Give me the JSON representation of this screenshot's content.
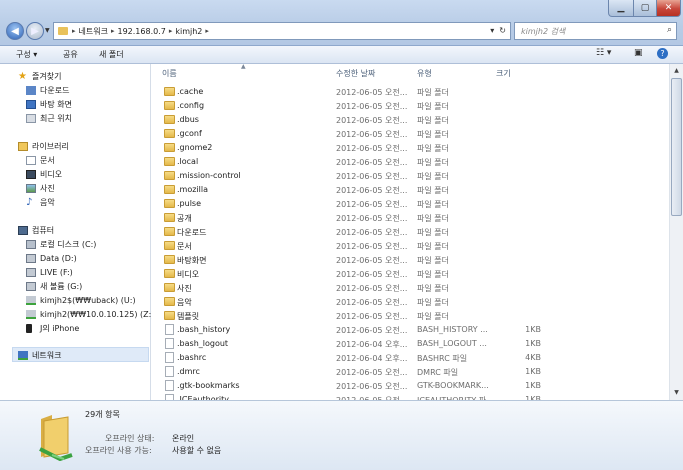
{
  "addressbar": {
    "crumbs": [
      "네트워크",
      "192.168.0.7",
      "kimjh2"
    ]
  },
  "search": {
    "placeholder": "kimjh2 검색"
  },
  "toolbar": {
    "organize": "구성 ▾",
    "share": "공유",
    "new_folder": "새 폴더"
  },
  "nav": {
    "favorites": "즐겨찾기",
    "downloads": "다운로드",
    "desktop": "바탕 화면",
    "recent": "최근 위치",
    "libraries": "라이브러리",
    "documents": "문서",
    "videos": "비디오",
    "pictures": "사진",
    "music": "음악",
    "computer": "컴퓨터",
    "local_disk": "로컬 디스크 (C:)",
    "data": "Data (D:)",
    "live": "LIVE (F:)",
    "new_volume": "새 볼륨 (G:)",
    "uback": "kimjh2$(₩₩uback) (U:)",
    "kimjh2_z": "kimjh2(₩₩10.0.10.125) (Z:)",
    "iphone": "J의 iPhone",
    "network": "네트워크"
  },
  "columns": {
    "name": "이름",
    "modified": "수정한 날짜",
    "type": "유형",
    "size": "크기"
  },
  "files": [
    {
      "name": ".cache",
      "date": "2012-06-05 오전...",
      "type": "파일 폴더",
      "size": "",
      "kind": "folder"
    },
    {
      "name": ".config",
      "date": "2012-06-05 오전...",
      "type": "파일 폴더",
      "size": "",
      "kind": "folder"
    },
    {
      "name": ".dbus",
      "date": "2012-06-05 오전...",
      "type": "파일 폴더",
      "size": "",
      "kind": "folder"
    },
    {
      "name": ".gconf",
      "date": "2012-06-05 오전...",
      "type": "파일 폴더",
      "size": "",
      "kind": "folder"
    },
    {
      "name": ".gnome2",
      "date": "2012-06-05 오전...",
      "type": "파일 폴더",
      "size": "",
      "kind": "folder"
    },
    {
      "name": ".local",
      "date": "2012-06-05 오전...",
      "type": "파일 폴더",
      "size": "",
      "kind": "folder"
    },
    {
      "name": ".mission-control",
      "date": "2012-06-05 오전...",
      "type": "파일 폴더",
      "size": "",
      "kind": "folder"
    },
    {
      "name": ".mozilla",
      "date": "2012-06-05 오전...",
      "type": "파일 폴더",
      "size": "",
      "kind": "folder"
    },
    {
      "name": ".pulse",
      "date": "2012-06-05 오전...",
      "type": "파일 폴더",
      "size": "",
      "kind": "folder"
    },
    {
      "name": "공개",
      "date": "2012-06-05 오전...",
      "type": "파일 폴더",
      "size": "",
      "kind": "folder"
    },
    {
      "name": "다운로드",
      "date": "2012-06-05 오전...",
      "type": "파일 폴더",
      "size": "",
      "kind": "folder"
    },
    {
      "name": "문서",
      "date": "2012-06-05 오전...",
      "type": "파일 폴더",
      "size": "",
      "kind": "folder"
    },
    {
      "name": "바탕화면",
      "date": "2012-06-05 오전...",
      "type": "파일 폴더",
      "size": "",
      "kind": "folder"
    },
    {
      "name": "비디오",
      "date": "2012-06-05 오전...",
      "type": "파일 폴더",
      "size": "",
      "kind": "folder"
    },
    {
      "name": "사진",
      "date": "2012-06-05 오전...",
      "type": "파일 폴더",
      "size": "",
      "kind": "folder"
    },
    {
      "name": "음악",
      "date": "2012-06-05 오전...",
      "type": "파일 폴더",
      "size": "",
      "kind": "folder"
    },
    {
      "name": "템플릿",
      "date": "2012-06-05 오전...",
      "type": "파일 폴더",
      "size": "",
      "kind": "folder"
    },
    {
      "name": ".bash_history",
      "date": "2012-06-05 오전...",
      "type": "BASH_HISTORY ...",
      "size": "1KB",
      "kind": "file"
    },
    {
      "name": ".bash_logout",
      "date": "2012-06-04 오후...",
      "type": "BASH_LOGOUT ...",
      "size": "1KB",
      "kind": "file"
    },
    {
      "name": ".bashrc",
      "date": "2012-06-04 오후...",
      "type": "BASHRC 파일",
      "size": "4KB",
      "kind": "file"
    },
    {
      "name": ".dmrc",
      "date": "2012-06-05 오전...",
      "type": "DMRC 파일",
      "size": "1KB",
      "kind": "file"
    },
    {
      "name": ".gtk-bookmarks",
      "date": "2012-06-05 오전...",
      "type": "GTK-BOOKMARK...",
      "size": "1KB",
      "kind": "file"
    },
    {
      "name": ".ICEauthority",
      "date": "2012-06-05 오전...",
      "type": "ICEAUTHORITY 파...",
      "size": "1KB",
      "kind": "file"
    }
  ],
  "details": {
    "count": "29개 항목",
    "offline_status_label": "오프라인 상태:",
    "offline_status_value": "온라인",
    "offline_avail_label": "오프라인 사용 가능:",
    "offline_avail_value": "사용할 수 없음"
  }
}
